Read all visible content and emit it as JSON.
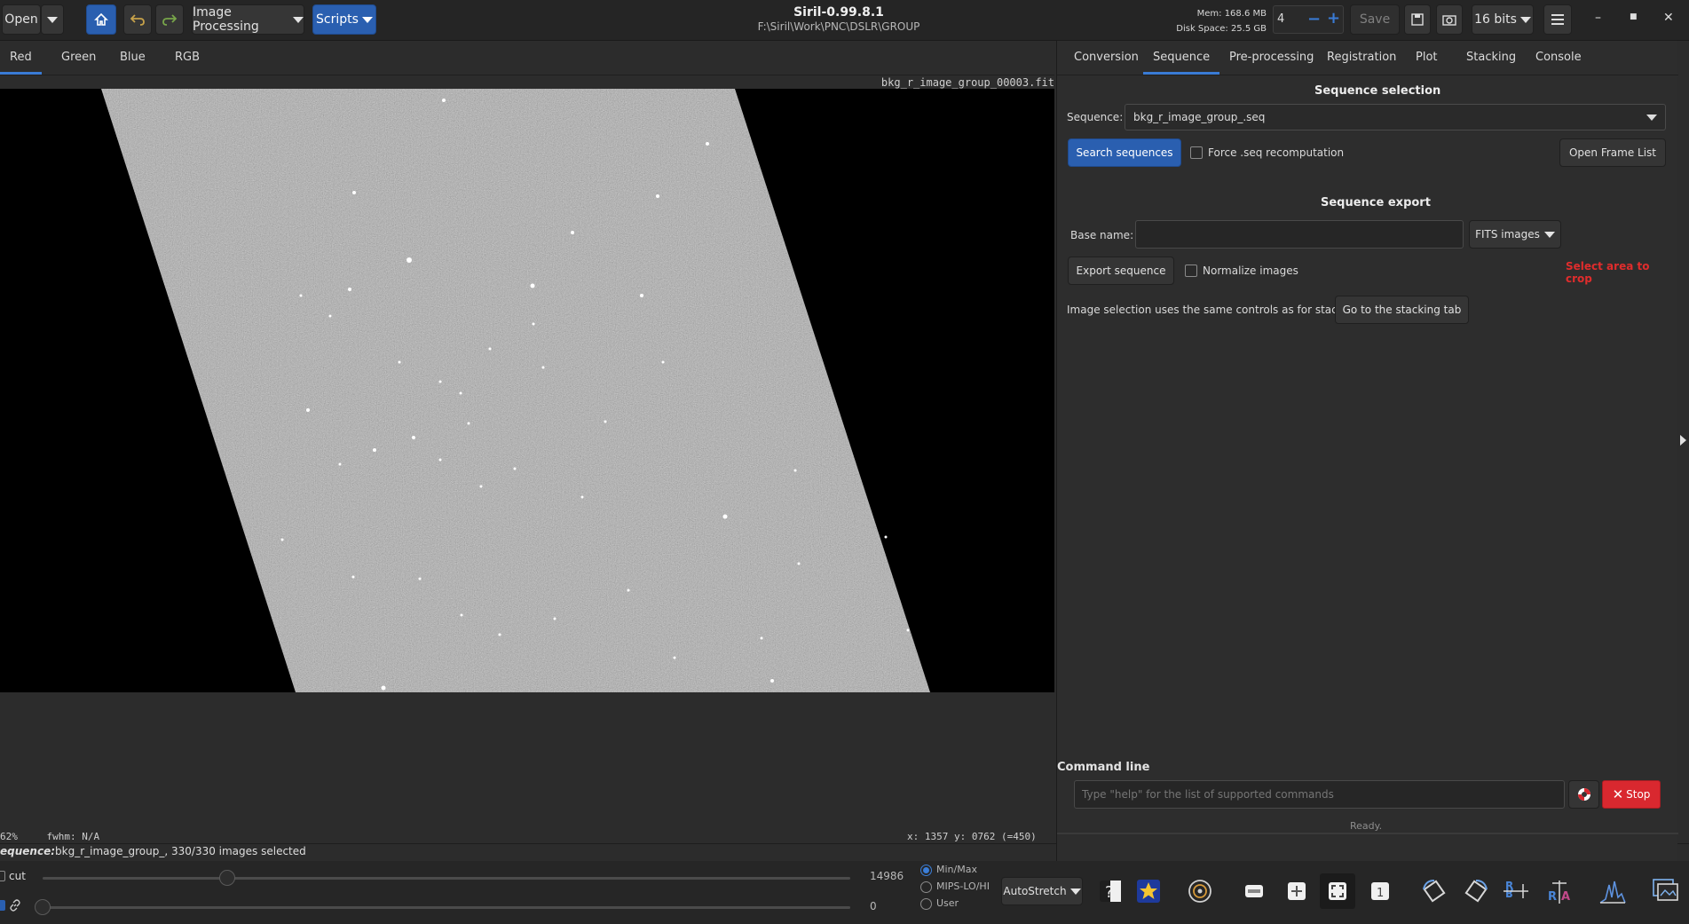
{
  "header": {
    "open_label": "Open",
    "image_processing_label": "Image Processing",
    "scripts_label": "Scripts",
    "title": "Siril-0.99.8.1",
    "path": "F:\\Siril\\Work\\PNC\\DSLR\\GROUP",
    "mem": "Mem: 168.6 MB",
    "disk": "Disk Space: 25.5 GB",
    "threads_value": "4",
    "save_label": "Save",
    "bits_label": "16 bits"
  },
  "channel_tabs": [
    "Red",
    "Green",
    "Blue",
    "RGB"
  ],
  "image": {
    "filename": "bkg_r_image_group_00003.fit"
  },
  "right_tabs": [
    "Conversion",
    "Sequence",
    "Pre-processing",
    "Registration",
    "Plot",
    "Stacking",
    "Console"
  ],
  "sequence": {
    "section_title": "Sequence selection",
    "seq_label": "Sequence:",
    "seq_value": "bkg_r_image_group_.seq",
    "search_button": "Search sequences",
    "force_label": "Force .seq recomputation",
    "open_frame_list": "Open Frame List",
    "export_title": "Sequence export",
    "base_name_label": "Base name:",
    "format_value": "FITS images",
    "export_button": "Export sequence",
    "normalize_label": "Normalize images",
    "crop_hint": "Select area to crop",
    "selection_note": "Image selection uses the same controls as for stacking:",
    "goto_stacking": "Go to the stacking tab"
  },
  "command": {
    "label": "Command line",
    "placeholder": "Type \"help\" for the list of supported commands",
    "stop_label": "Stop",
    "status": "Ready."
  },
  "status": {
    "zoom": "62%",
    "fwhm": "fwhm: N/A",
    "coords": "x: 1357 y: 0762 (=450)",
    "sequence_prefix": "equence:",
    "sequence_info": "bkg_r_image_group_, 330/330 images selected"
  },
  "bottom": {
    "cut_label": "cut",
    "hi_value": "14986",
    "lo_value": "0",
    "radio_minmax": "Min/Max",
    "radio_mips": "MIPS-LO/HI",
    "radio_user": "User",
    "stretch_label": "AutoStretch"
  },
  "colors": {
    "accent": "#2a5fb0",
    "stop": "#d9282f",
    "crop_hint": "#e02c2c"
  }
}
